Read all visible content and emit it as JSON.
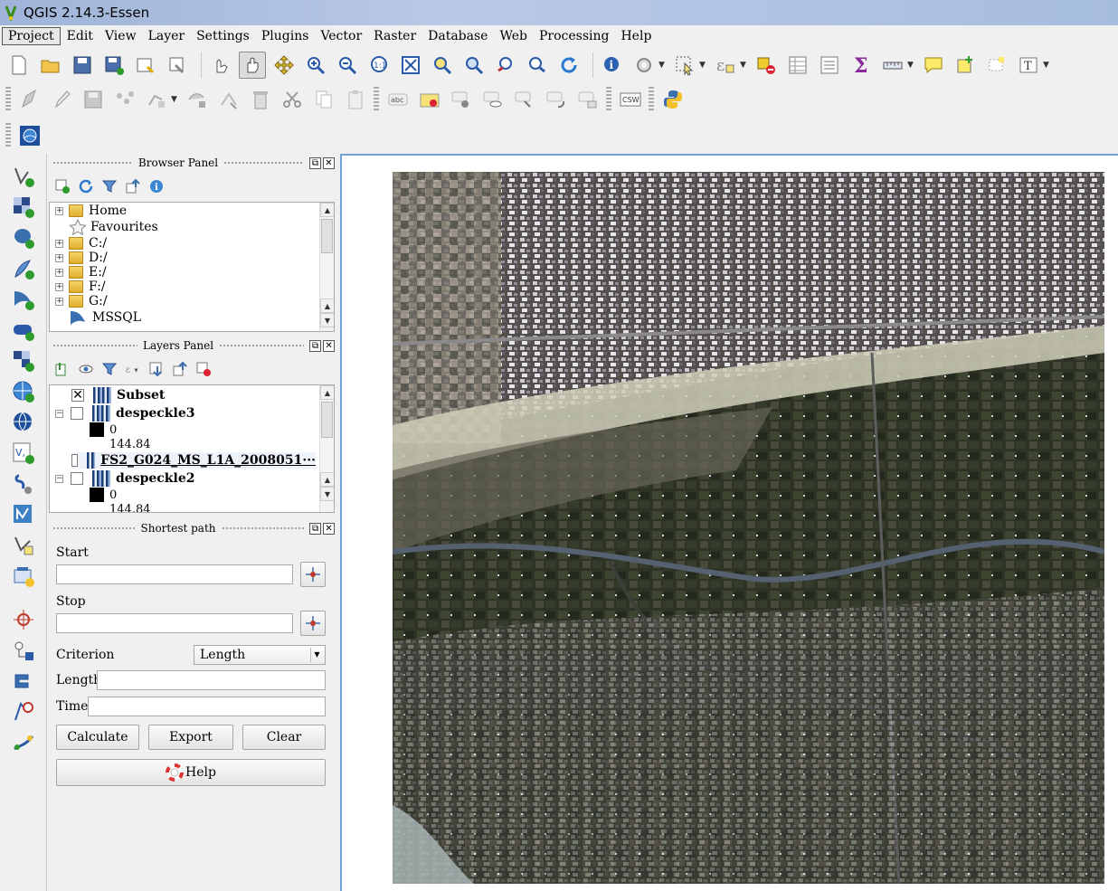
{
  "window": {
    "title": "QGIS 2.14.3-Essen"
  },
  "menu": {
    "items": [
      "Project",
      "Edit",
      "View",
      "Layer",
      "Settings",
      "Plugins",
      "Vector",
      "Raster",
      "Database",
      "Web",
      "Processing",
      "Help"
    ],
    "active": "Project"
  },
  "toolbar": {
    "csw_label": "CSW",
    "abc_label": "abc"
  },
  "browser_panel": {
    "title": "Browser Panel",
    "items": [
      {
        "label": "Home",
        "icon": "folder-icon",
        "expandable": true
      },
      {
        "label": "Favourites",
        "icon": "star-icon",
        "expandable": false
      },
      {
        "label": "C:/",
        "icon": "folder-icon",
        "expandable": true
      },
      {
        "label": "D:/",
        "icon": "folder-icon",
        "expandable": true
      },
      {
        "label": "E:/",
        "icon": "folder-icon",
        "expandable": true
      },
      {
        "label": "F:/",
        "icon": "folder-icon",
        "expandable": true
      },
      {
        "label": "G:/",
        "icon": "folder-icon",
        "expandable": true
      },
      {
        "label": "MSSQL",
        "icon": "mssql-icon",
        "expandable": false
      }
    ]
  },
  "layers_panel": {
    "title": "Layers Panel",
    "layers": [
      {
        "name": "Subset",
        "checked": true,
        "bold": true
      },
      {
        "name": "despeckle3",
        "checked": false,
        "bold": true,
        "legend": [
          "0",
          "144.84"
        ]
      },
      {
        "name": "FS2_G024_MS_L1A_2008051···",
        "checked": false,
        "bold": true,
        "underline": true
      },
      {
        "name": "despeckle2",
        "checked": false,
        "bold": true,
        "legend": [
          "0",
          "144.84"
        ]
      }
    ]
  },
  "shortest_path": {
    "title": "Shortest path",
    "start_label": "Start",
    "start_value": "",
    "stop_label": "Stop",
    "stop_value": "",
    "criterion_label": "Criterion",
    "criterion_value": "Length",
    "length_label": "Length",
    "length_value": "",
    "time_label": "Time",
    "time_value": "",
    "calculate_label": "Calculate",
    "export_label": "Export",
    "clear_label": "Clear",
    "help_label": "Help"
  },
  "panel_buttons": {
    "float": "⧉",
    "close": "✕"
  }
}
